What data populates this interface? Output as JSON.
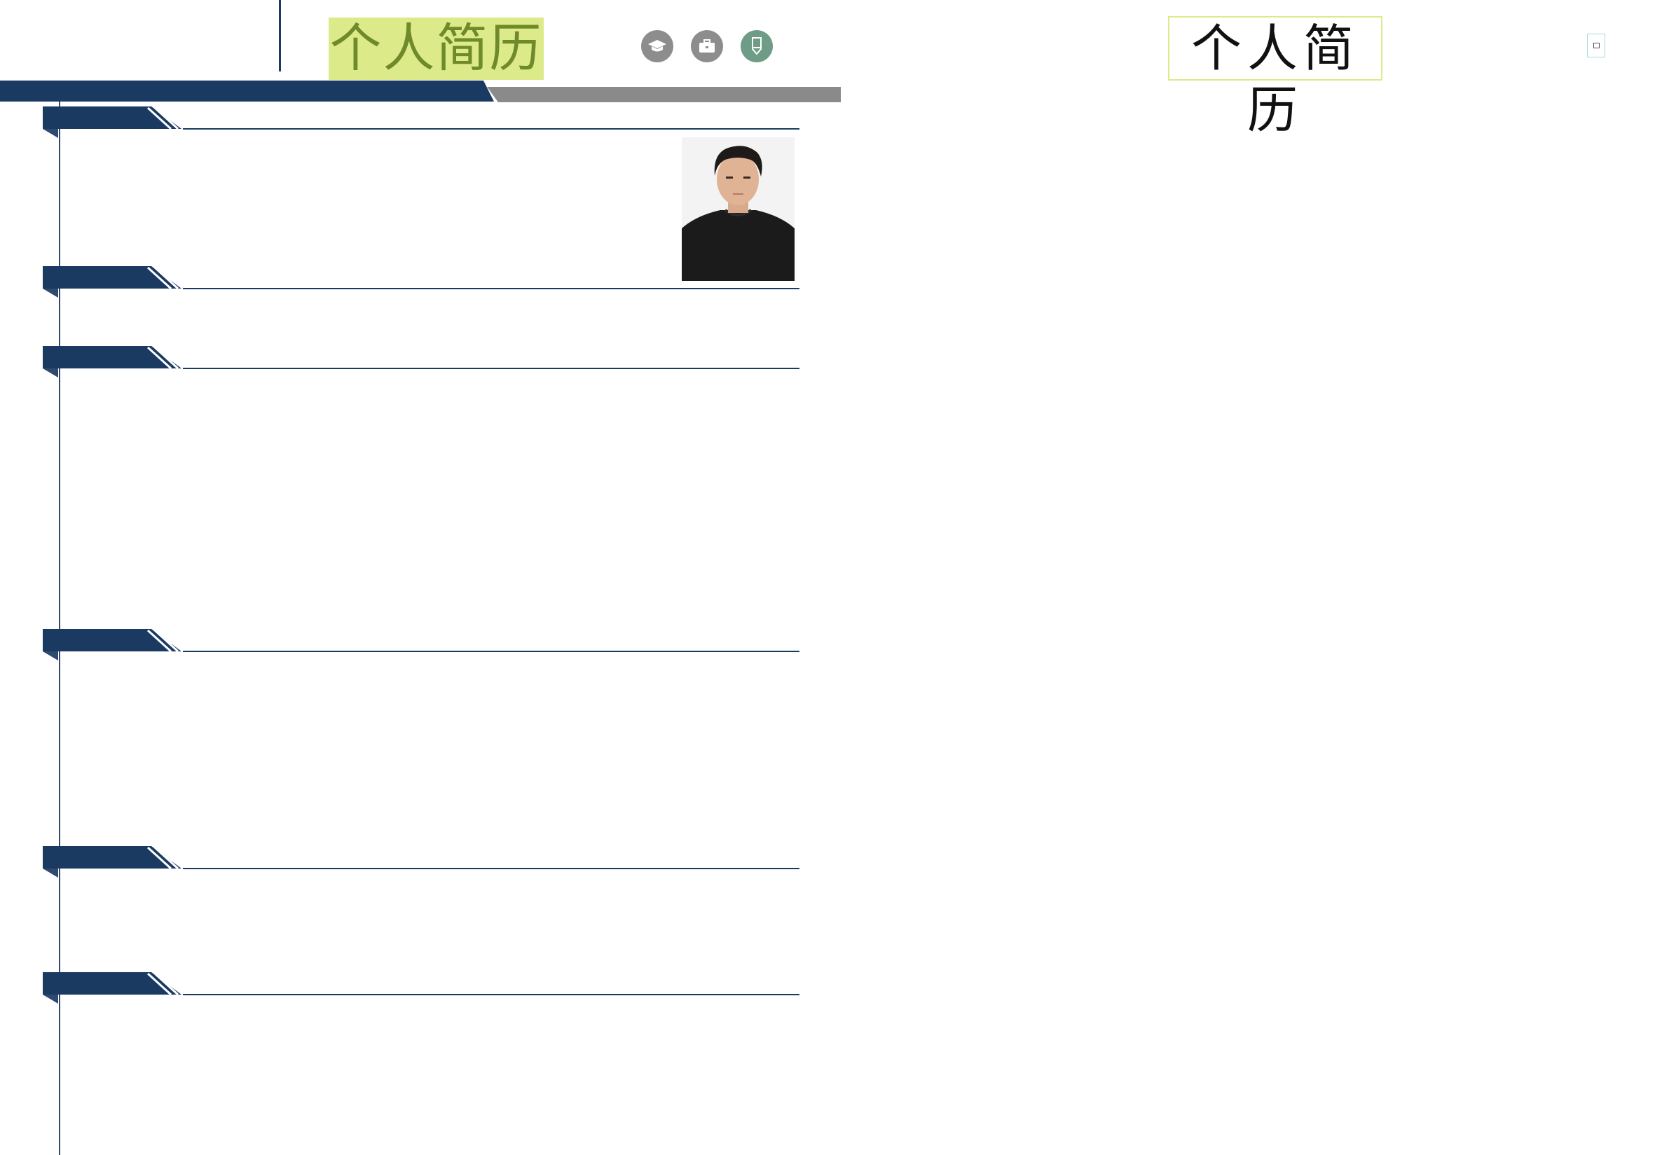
{
  "header": {
    "title": "个人简历",
    "icons": [
      "graduation-cap-icon",
      "briefcase-icon",
      "pencil-icon"
    ]
  },
  "right_panel": {
    "title": "个人简历"
  },
  "colors": {
    "navy": "#1a3a62",
    "gray_band": "#8a8a8a",
    "title_highlight": "#dcea8a",
    "title_text": "#6f8a2a",
    "icon_gray": "#8d8d8d",
    "icon_green": "#6e9c86"
  },
  "sections_count_label": "",
  "photo": {
    "subject": "profile-photo"
  }
}
